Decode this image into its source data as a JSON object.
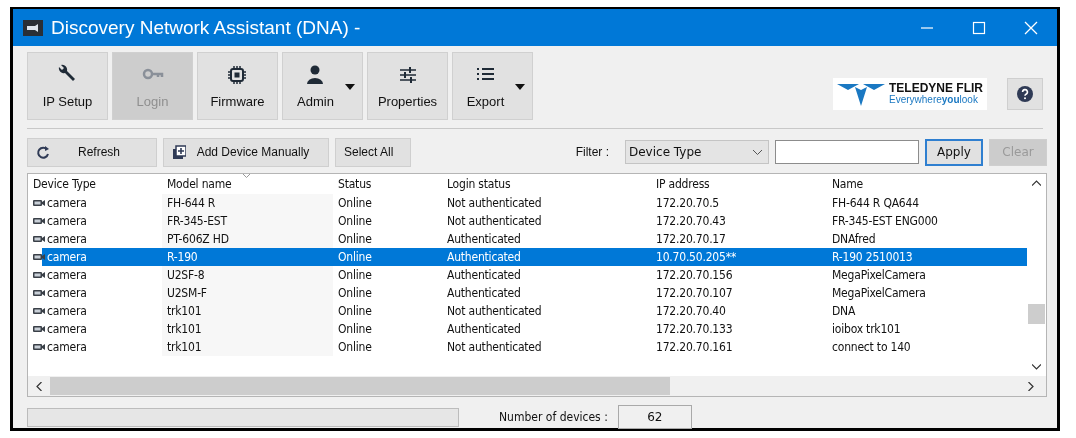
{
  "window": {
    "title": "Discovery Network Assistant (DNA) -"
  },
  "toolbar": [
    {
      "label": "IP Setup",
      "disabled": false,
      "dropdown": false
    },
    {
      "label": "Login",
      "disabled": true,
      "dropdown": false
    },
    {
      "label": "Firmware",
      "disabled": false,
      "dropdown": false
    },
    {
      "label": "Admin",
      "disabled": false,
      "dropdown": true
    },
    {
      "label": "Properties",
      "disabled": false,
      "dropdown": false
    },
    {
      "label": "Export",
      "disabled": false,
      "dropdown": true
    }
  ],
  "logo": {
    "name": "TELEDYNE FLIR",
    "tagline": "Everywhere**you**look"
  },
  "actions": [
    {
      "label": "Refresh"
    },
    {
      "label": "Add Device Manually"
    },
    {
      "label": "Select All"
    }
  ],
  "filter": {
    "label": "Filter :",
    "field": "Device Type",
    "apply": {
      "label": "Apply",
      "disabled": false
    },
    "clear": {
      "label": "Clear",
      "disabled": true
    }
  },
  "table": {
    "columns": [
      {
        "label": "Device Type",
        "sorted": false
      },
      {
        "label": "Model name",
        "sorted": true
      },
      {
        "label": "Status",
        "sorted": false
      },
      {
        "label": "Login status",
        "sorted": false
      },
      {
        "label": "IP address",
        "sorted": false
      },
      {
        "label": "Name",
        "sorted": false
      }
    ],
    "rows": [
      {
        "selected": false,
        "cells": [
          "camera",
          "FH-644 R",
          "Online",
          "Not authenticated",
          "172.20.70.5",
          "FH-644 R QA644"
        ]
      },
      {
        "selected": false,
        "cells": [
          "camera",
          "FR-345-EST",
          "Online",
          "Not authenticated",
          "172.20.70.43",
          "FR-345-EST ENG000"
        ]
      },
      {
        "selected": false,
        "cells": [
          "camera",
          "PT-606Z HD",
          "Online",
          "Authenticated",
          "172.20.70.17",
          "DNAfred"
        ]
      },
      {
        "selected": true,
        "cells": [
          "camera",
          "R-190",
          "Online",
          "Authenticated",
          "10.70.50.205**",
          "R-190 2510013"
        ]
      },
      {
        "selected": false,
        "cells": [
          "camera",
          "U2SF-8",
          "Online",
          "Authenticated",
          "172.20.70.156",
          "MegaPixelCamera"
        ]
      },
      {
        "selected": false,
        "cells": [
          "camera",
          "U2SM-F",
          "Online",
          "Authenticated",
          "172.20.70.107",
          "MegaPixelCamera"
        ]
      },
      {
        "selected": false,
        "cells": [
          "camera",
          "trk101",
          "Online",
          "Not authenticated",
          "172.20.70.40",
          "DNA"
        ]
      },
      {
        "selected": false,
        "cells": [
          "camera",
          "trk101",
          "Online",
          "Authenticated",
          "172.20.70.133",
          "ioibox trk101"
        ]
      },
      {
        "selected": false,
        "cells": [
          "camera",
          "trk101",
          "Online",
          "Not authenticated",
          "172.20.70.161",
          "connect to 140"
        ]
      }
    ]
  },
  "footer": {
    "label": "Number of devices :",
    "count": "62"
  }
}
